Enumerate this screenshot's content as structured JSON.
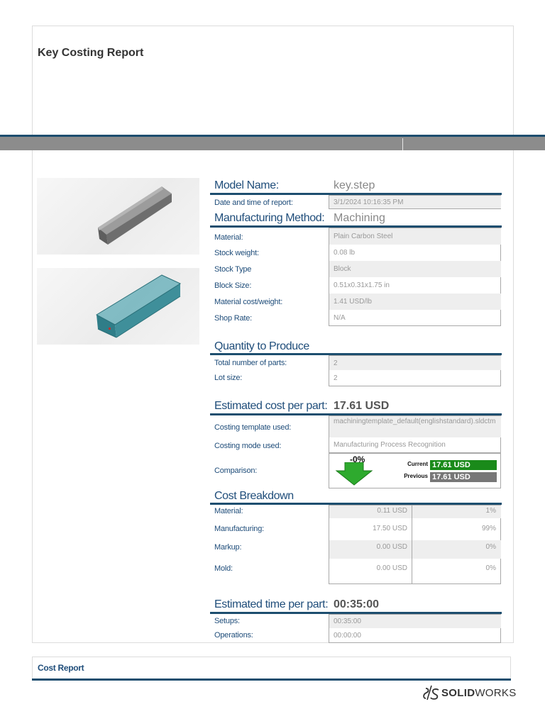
{
  "header": {
    "title": "Key Costing Report"
  },
  "model": {
    "label": "Model Name:",
    "value": "key.step"
  },
  "report_date": {
    "label": "Date and time of report:",
    "value": "3/1/2024 10:16:35 PM"
  },
  "method": {
    "label": "Manufacturing Method:",
    "value": "Machining"
  },
  "details": [
    {
      "label": "Material:",
      "value": "Plain Carbon Steel"
    },
    {
      "label": "Stock weight:",
      "value": "0.08 lb"
    },
    {
      "label": "Stock Type",
      "value": "Block"
    },
    {
      "label": "Block Size:",
      "value": "0.51x0.31x1.75 in"
    },
    {
      "label": "Material cost/weight:",
      "value": "1.41 USD/lb"
    },
    {
      "label": "Shop Rate:",
      "value": "N/A"
    }
  ],
  "quantity": {
    "heading": "Quantity to Produce",
    "rows": [
      {
        "label": "Total number of parts:",
        "value": "2"
      },
      {
        "label": "Lot size:",
        "value": "2"
      }
    ]
  },
  "cost_per_part": {
    "label": "Estimated cost per part:",
    "value": "17.61 USD",
    "template_label": "Costing template used:",
    "template_value": "machiningtemplate_default(englishstandard).sldctm",
    "mode_label": "Costing mode used:",
    "mode_value": "Manufacturing Process Recognition",
    "comparison_label": "Comparison:",
    "comparison": {
      "percent": "-0%",
      "current_label": "Current",
      "current_value": "17.61 USD",
      "previous_label": "Previous",
      "previous_value": "17.61 USD",
      "arrow_color": "#2eaa2e"
    }
  },
  "breakdown": {
    "heading": "Cost Breakdown",
    "rows": [
      {
        "label": "Material:",
        "amount": "0.11 USD",
        "percent": "1%"
      },
      {
        "label": "Manufacturing:",
        "amount": "17.50 USD",
        "percent": "99%"
      },
      {
        "label": "Markup:",
        "amount": "0.00 USD",
        "percent": "0%"
      },
      {
        "label": "Mold:",
        "amount": "0.00 USD",
        "percent": "0%"
      }
    ]
  },
  "time_per_part": {
    "label": "Estimated time per part:",
    "value": "00:35:00",
    "rows": [
      {
        "label": "Setups:",
        "value": "00:35:00"
      },
      {
        "label": "Operations:",
        "value": "00:00:00"
      }
    ]
  },
  "footer": {
    "title": "Cost Report",
    "logo_prefix": "SOLID",
    "logo_suffix": "WORKS"
  },
  "colors": {
    "accent": "#1d4e6f",
    "label_blue": "#1f4d7a",
    "model_gray": "#6a6a6a",
    "stock_teal": "#3f8f9a"
  }
}
